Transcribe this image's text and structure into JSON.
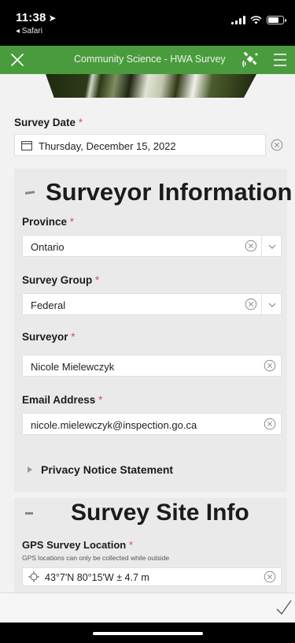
{
  "status": {
    "time": "11:38",
    "back_app": "◂ Safari"
  },
  "header": {
    "title": "Community Science - HWA Survey"
  },
  "survey_date": {
    "label": "Survey Date",
    "required_mark": "*",
    "value": "Thursday, December 15, 2022"
  },
  "surveyor_section": {
    "title": "Surveyor Information",
    "province": {
      "label": "Province",
      "required_mark": "*",
      "value": "Ontario"
    },
    "survey_group": {
      "label": "Survey Group",
      "required_mark": "*",
      "value": "Federal"
    },
    "surveyor": {
      "label": "Surveyor",
      "required_mark": "*",
      "value": "Nicole Mielewczyk"
    },
    "email": {
      "label": "Email Address",
      "required_mark": "*",
      "value": "nicole.mielewczyk@inspection.go.ca"
    },
    "privacy": {
      "label": "Privacy Notice Statement"
    }
  },
  "site_section": {
    "title": "Survey Site Info",
    "gps": {
      "label": "GPS Survey Location",
      "required_mark": "*",
      "hint": "GPS locations can only be collected while outside",
      "value": "43°7'N 80°15'W ± 4.7 m"
    }
  },
  "colors": {
    "header_green": "#4a9b3e",
    "required_red": "#c25a4b"
  },
  "icons": [
    "close-icon",
    "satellite-icon",
    "menu-icon",
    "calendar-icon",
    "clear-icon",
    "chevron-down-icon",
    "disclosure-triangle-icon",
    "crosshair-icon",
    "checkmark-icon"
  ]
}
